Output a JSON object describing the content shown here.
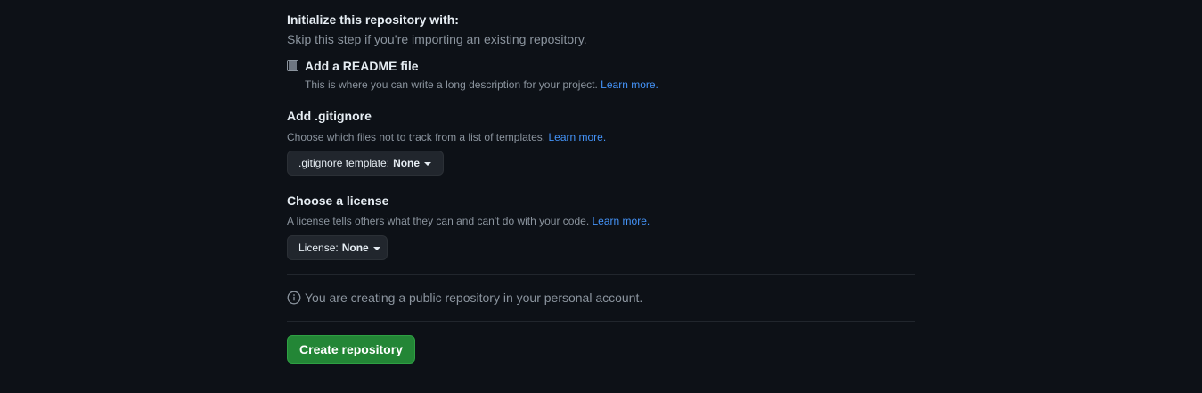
{
  "initialize": {
    "title": "Initialize this repository with:",
    "subtitle": "Skip this step if you’re importing an existing repository."
  },
  "readme": {
    "label": "Add a README file",
    "description": "This is where you can write a long description for your project.",
    "learn_more": "Learn more.",
    "checked": false
  },
  "gitignore": {
    "title": "Add .gitignore",
    "description": "Choose which files not to track from a list of templates.",
    "learn_more": "Learn more.",
    "select_prefix": ".gitignore template:",
    "select_value": "None"
  },
  "license": {
    "title": "Choose a license",
    "description": "A license tells others what they can and can't do with your code.",
    "learn_more": "Learn more.",
    "select_prefix": "License:",
    "select_value": "None"
  },
  "info": {
    "icon": "info-icon",
    "message": "You are creating a public repository in your personal account."
  },
  "actions": {
    "create_label": "Create repository"
  },
  "colors": {
    "background": "#0d1117",
    "link": "#4493f8",
    "primary_button": "#238636"
  }
}
